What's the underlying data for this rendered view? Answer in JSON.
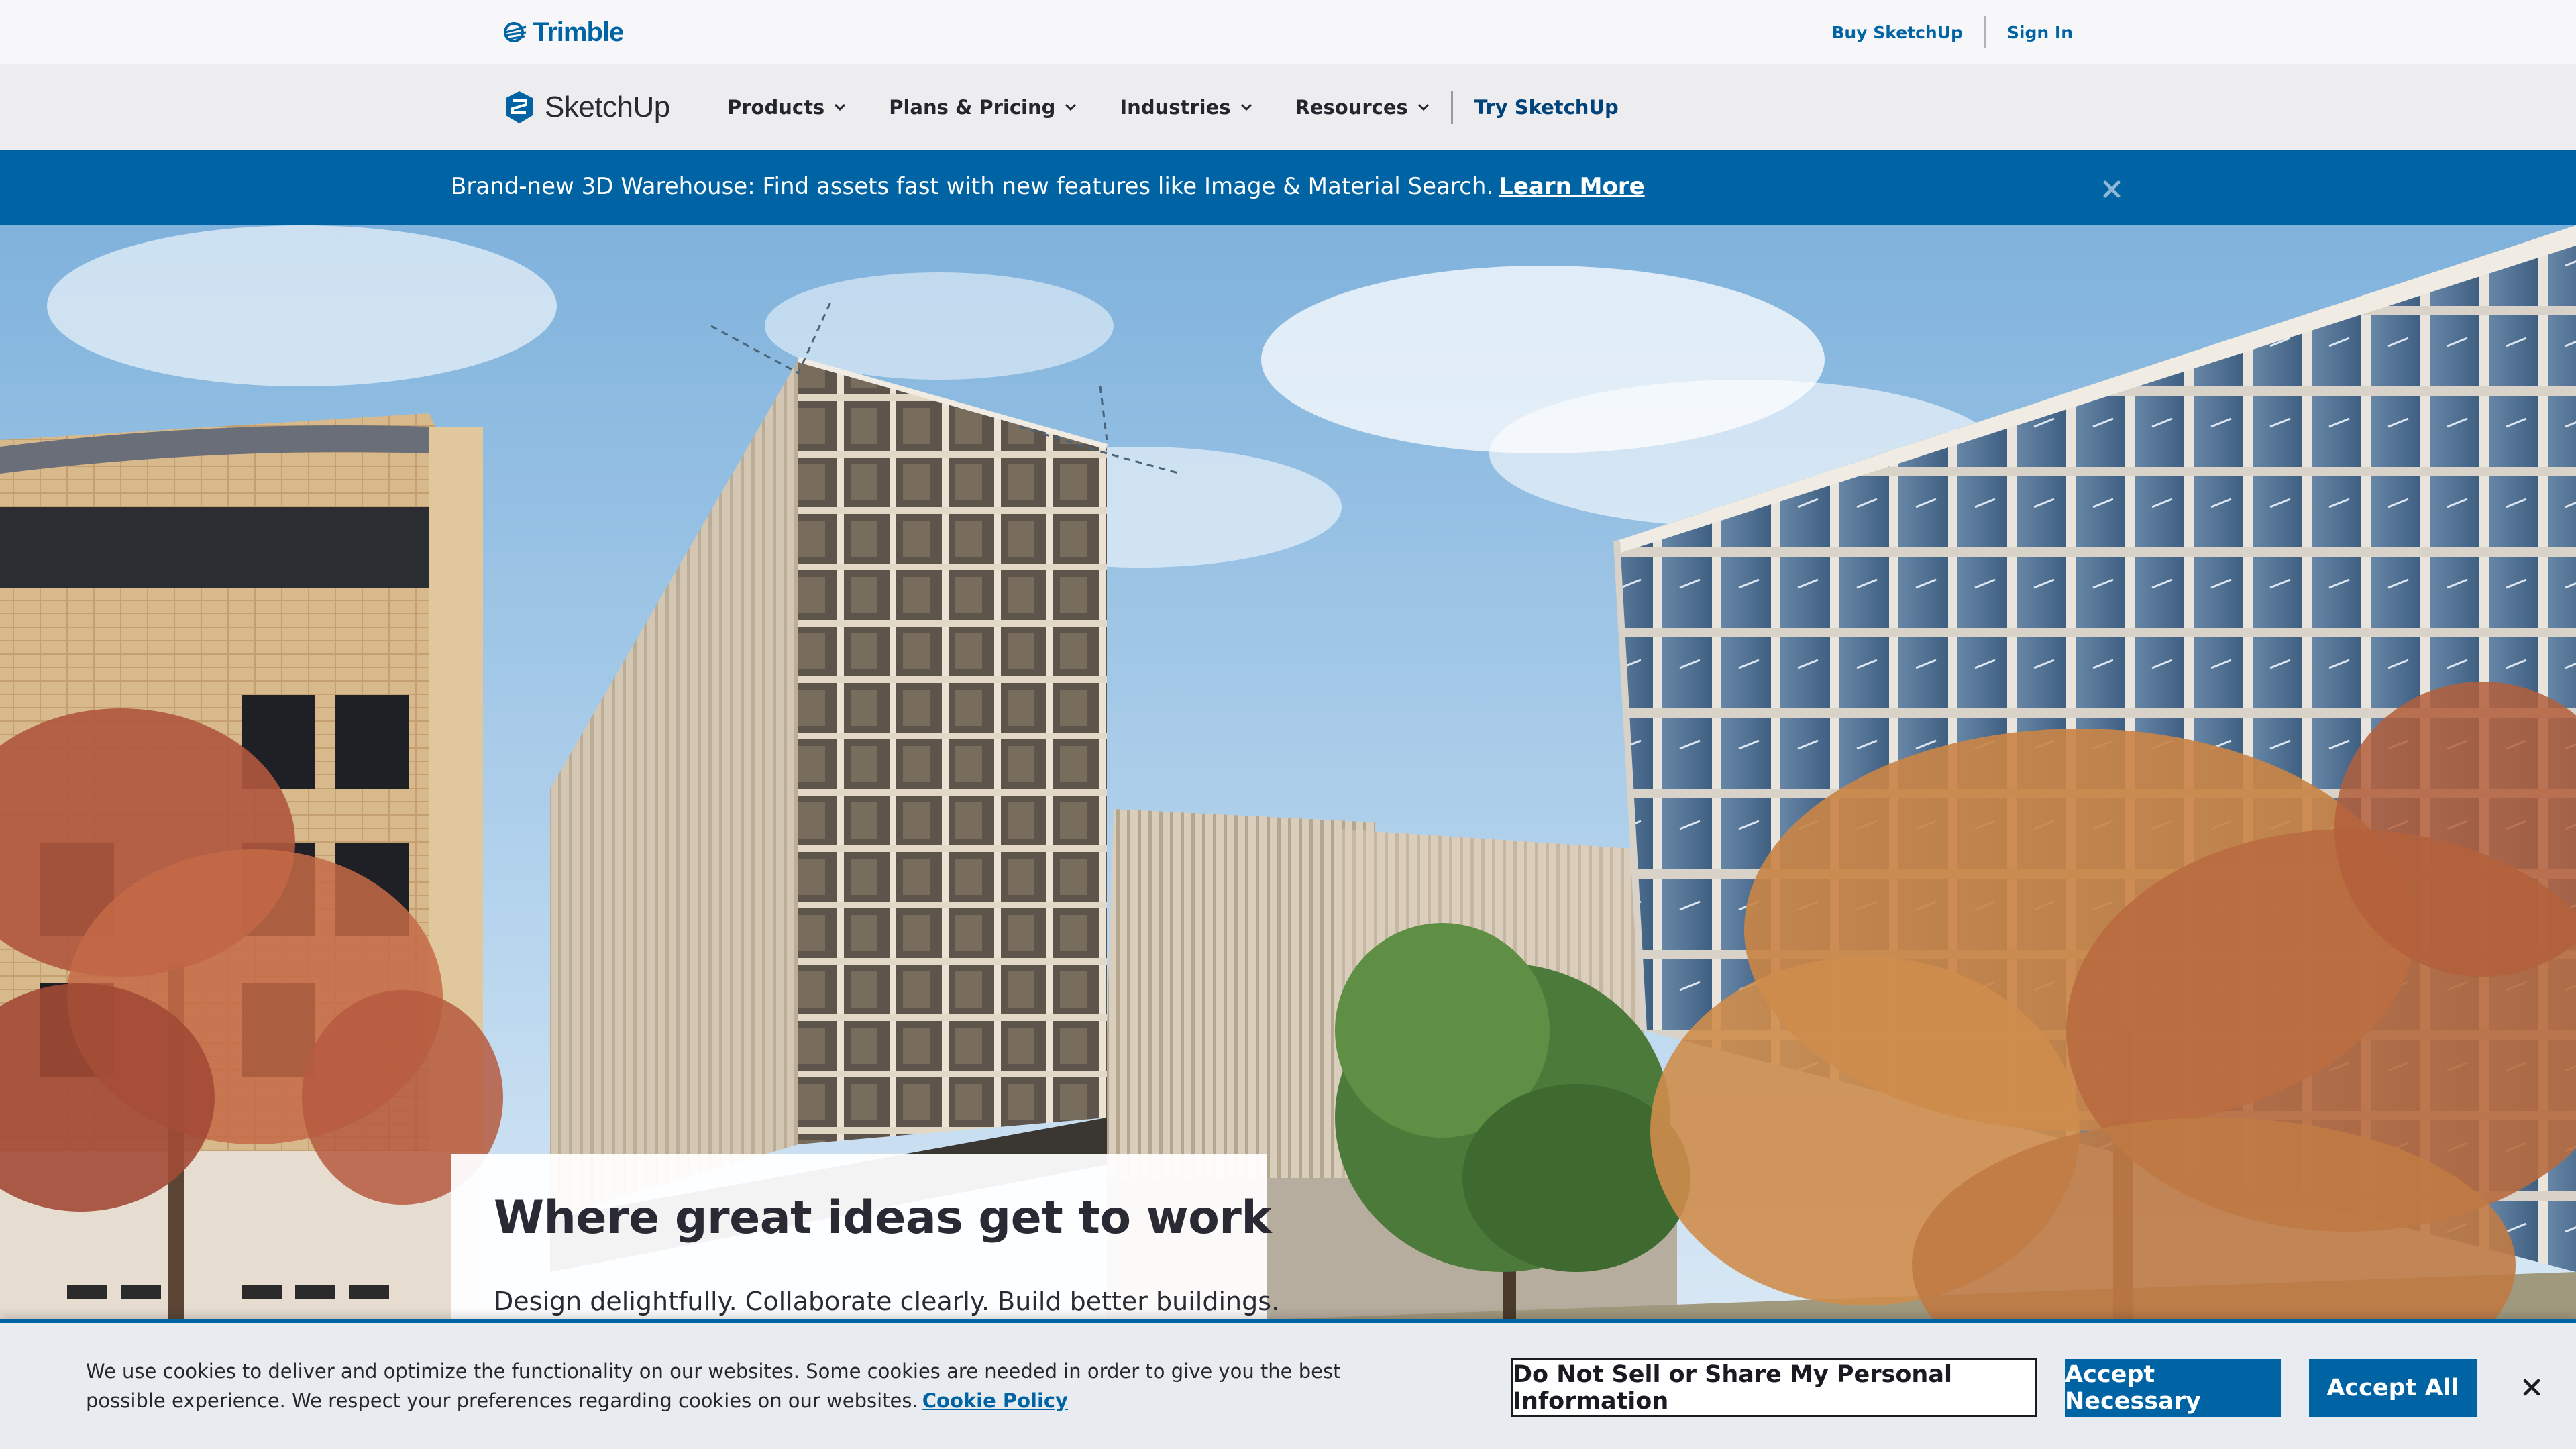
{
  "trimble": {
    "logo_text": "Trimble",
    "buy_label": "Buy SketchUp",
    "signin_label": "Sign In"
  },
  "nav": {
    "logo_text": "SketchUp",
    "items": [
      {
        "label": "Products",
        "icon": "chevron-down-icon"
      },
      {
        "label": "Plans & Pricing",
        "icon": "chevron-down-icon"
      },
      {
        "label": "Industries",
        "icon": "chevron-down-icon"
      },
      {
        "label": "Resources",
        "icon": "chevron-down-icon"
      }
    ],
    "cta_label": "Try SketchUp"
  },
  "announcement": {
    "text": "Brand-new 3D Warehouse: Find assets fast with new features like Image & Material Search.",
    "link_label": "Learn More",
    "close_icon": "close-icon"
  },
  "hero": {
    "title": "Where great ideas get to work",
    "subtitle": "Design delightfully. Collaborate clearly. Build better buildings."
  },
  "cookie": {
    "text": "We use cookies to deliver and optimize the functionality on our websites. Some cookies are needed in order to give you the best possible experience. We respect your preferences regarding cookies on our websites.",
    "policy_link": "Cookie Policy",
    "do_not_sell_label": "Do Not Sell or Share My Personal Information",
    "accept_necessary_label": "Accept Necessary",
    "accept_all_label": "Accept All",
    "close_icon": "close-icon"
  },
  "colors": {
    "brand_blue": "#0063a3",
    "dark_blue": "#00437b",
    "text_dark": "#2a2a35"
  }
}
